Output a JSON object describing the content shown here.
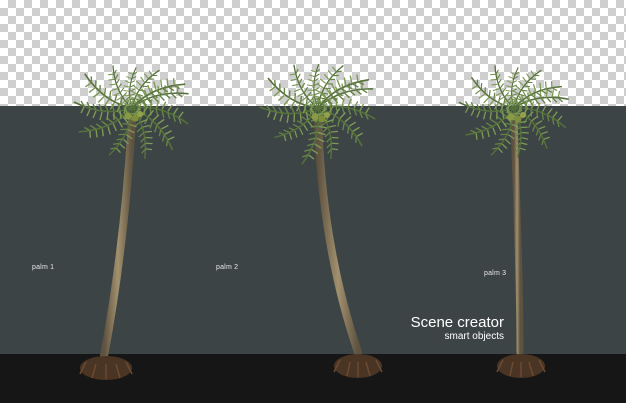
{
  "image": {
    "description_free": true,
    "palms": [
      {
        "label": "palm 1"
      },
      {
        "label": "palm 2"
      },
      {
        "label": "palm 3"
      }
    ],
    "brand": {
      "title": "Scene creator",
      "subtitle": "smart objects"
    },
    "colors": {
      "panel": "#3d4446",
      "ground": "#161616",
      "frond": "#6f8a4a",
      "trunk": "#8a7a5e",
      "roots": "#5a3e2a"
    }
  }
}
